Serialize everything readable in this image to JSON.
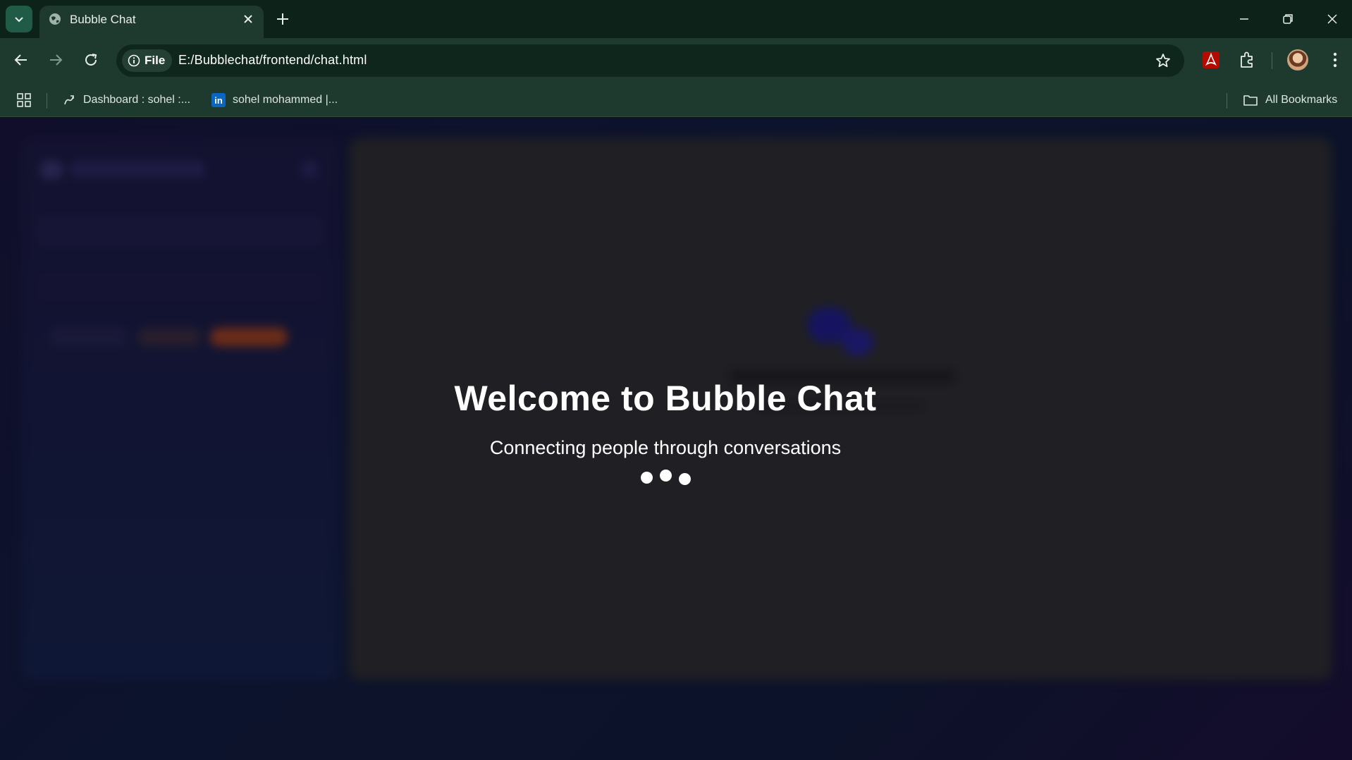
{
  "browser": {
    "tab": {
      "title": "Bubble Chat"
    },
    "address": {
      "chip_label": "File",
      "url": "E:/Bubblechat/frontend/chat.html"
    },
    "bookmarks": [
      {
        "label": "Dashboard : sohel :...",
        "icon": "github-style-icon"
      },
      {
        "label": "sohel mohammed |...",
        "icon": "linkedin-icon",
        "badge": "in"
      }
    ],
    "all_bookmarks_label": "All Bookmarks"
  },
  "page": {
    "title": "Welcome to Bubble Chat",
    "subtitle": "Connecting people through conversations",
    "loading_dots": 3
  },
  "colors": {
    "chrome_bg": "#1e3a2f",
    "tabstrip_bg": "#0d2219",
    "page_bg": "#15123a",
    "panel_bg": "#2c2c2e",
    "accent": "#a3401c"
  }
}
